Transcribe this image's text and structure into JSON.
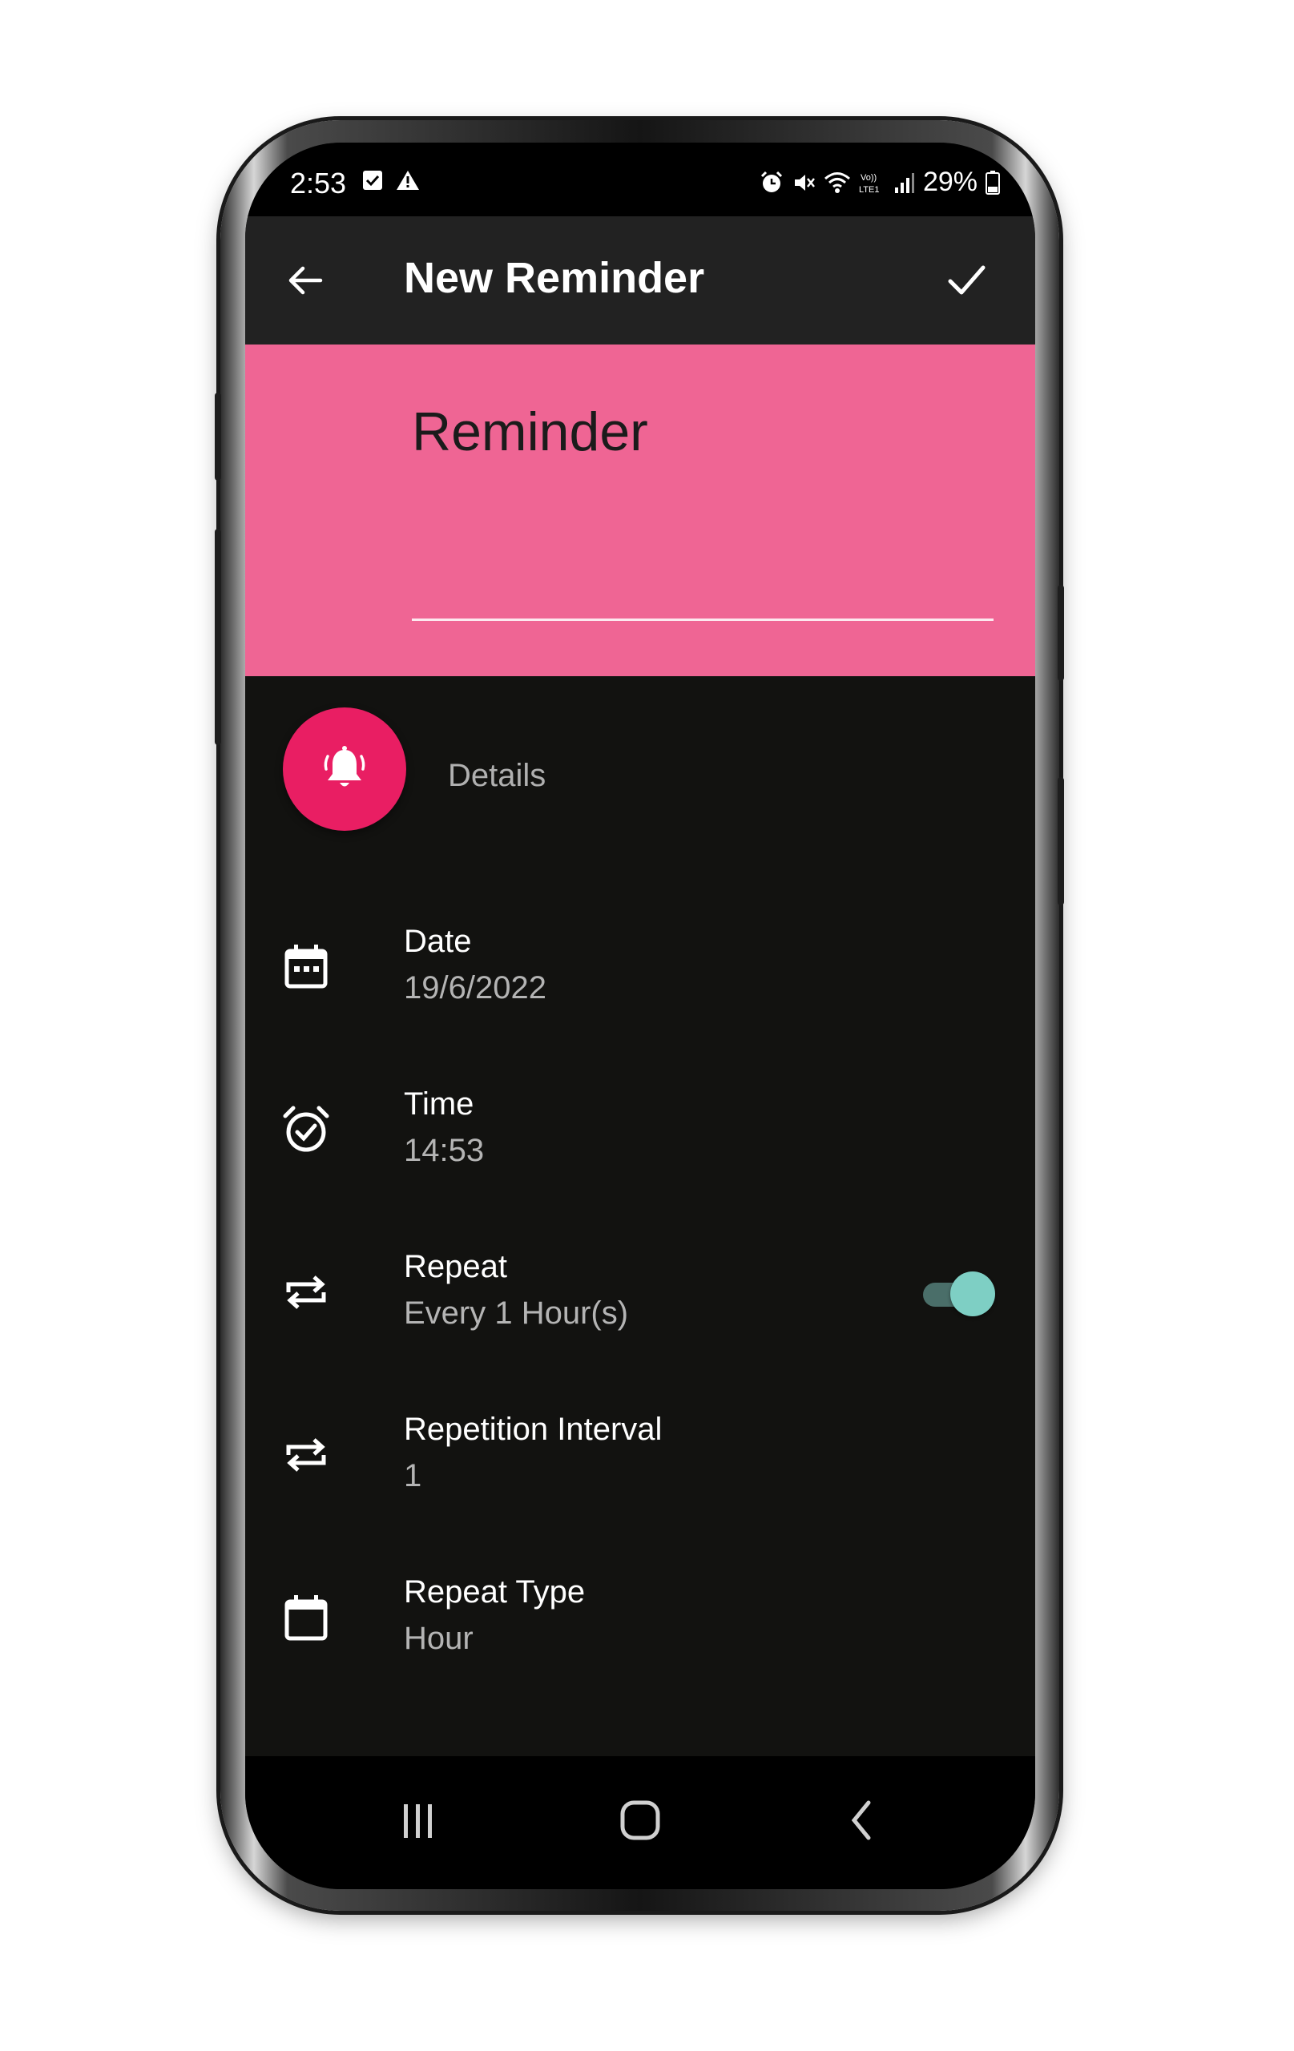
{
  "status_bar": {
    "time": "2:53",
    "battery": "29%",
    "left_icons": [
      "checkbox-notification-icon",
      "warning-icon"
    ],
    "right_icons": [
      "alarm-icon",
      "mute-icon",
      "wifi-icon",
      "volte-icon",
      "signal-icon",
      "battery-icon"
    ]
  },
  "app_bar": {
    "title": "New Reminder",
    "back_icon": "arrow-left-icon",
    "save_icon": "check-icon"
  },
  "header": {
    "title_value": "Reminder",
    "color": "#ef6594"
  },
  "details": {
    "label": "Details",
    "fab_icon": "ringing-bell-icon",
    "fab_color": "#e91e63"
  },
  "rows": [
    {
      "label": "Date",
      "value": "19/6/2022",
      "icon": "calendar-icon"
    },
    {
      "label": "Time",
      "value": "14:53",
      "icon": "alarm-check-icon"
    },
    {
      "label": "Repeat",
      "value": "Every 1 Hour(s)",
      "icon": "repeat-icon",
      "toggle_on": true
    },
    {
      "label": "Repetition Interval",
      "value": "1",
      "icon": "repeat-icon"
    },
    {
      "label": "Repeat Type",
      "value": "Hour",
      "icon": "calendar-blank-icon"
    }
  ],
  "nav_bar": {
    "buttons": [
      "recent-apps-icon",
      "home-icon",
      "back-chevron-icon"
    ]
  },
  "colors": {
    "accent": "#7ecfc4",
    "background": "#121210",
    "app_bar": "#222222"
  }
}
